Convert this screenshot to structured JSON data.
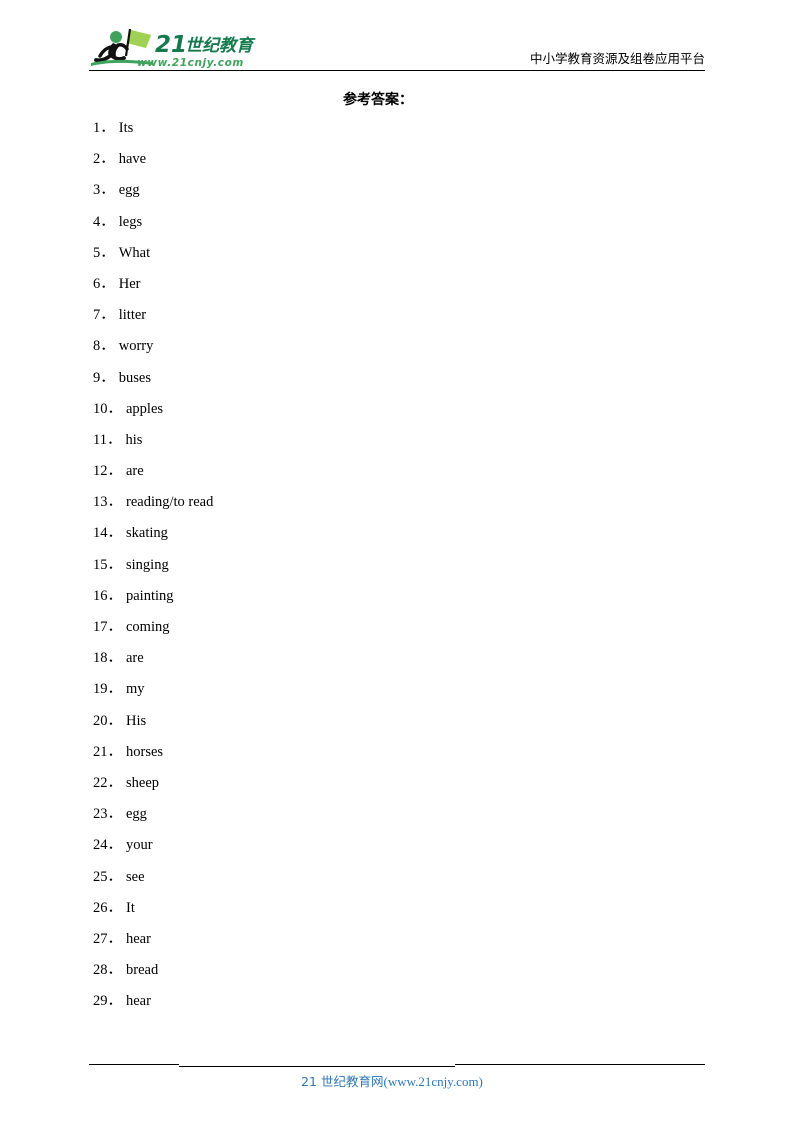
{
  "header": {
    "logo": {
      "brand_number": "21",
      "brand_cn": "世纪教育",
      "brand_url": "www.21cnjy.com",
      "icon_name": "running-figure-with-flag-logo",
      "colors": {
        "brand_dark_green": "#157a4e",
        "brand_mid_green": "#3fa35e",
        "brand_light_green": "#7ac143",
        "figure_black": "#111111"
      }
    },
    "tagline": "中小学教育资源及组卷应用平台"
  },
  "title": "参考答案：",
  "answers": [
    {
      "num": "1．",
      "text": "Its"
    },
    {
      "num": "2．",
      "text": "have"
    },
    {
      "num": "3．",
      "text": "egg"
    },
    {
      "num": "4．",
      "text": "legs"
    },
    {
      "num": "5．",
      "text": "What"
    },
    {
      "num": "6．",
      "text": "Her"
    },
    {
      "num": "7．",
      "text": "litter"
    },
    {
      "num": "8．",
      "text": "worry"
    },
    {
      "num": "9．",
      "text": "buses"
    },
    {
      "num": "10．",
      "text": "apples"
    },
    {
      "num": "11．",
      "text": "his"
    },
    {
      "num": "12．",
      "text": "are"
    },
    {
      "num": "13．",
      "text": "reading/to read"
    },
    {
      "num": "14．",
      "text": "skating"
    },
    {
      "num": "15．",
      "text": "singing"
    },
    {
      "num": "16．",
      "text": "painting"
    },
    {
      "num": "17．",
      "text": "coming"
    },
    {
      "num": "18．",
      "text": "are"
    },
    {
      "num": "19．",
      "text": "my"
    },
    {
      "num": "20．",
      "text": "His"
    },
    {
      "num": "21．",
      "text": "horses"
    },
    {
      "num": "22．",
      "text": "sheep"
    },
    {
      "num": "23．",
      "text": "egg"
    },
    {
      "num": "24．",
      "text": "your"
    },
    {
      "num": "25．",
      "text": "see"
    },
    {
      "num": "26．",
      "text": "It"
    },
    {
      "num": "27．",
      "text": "hear"
    },
    {
      "num": "28．",
      "text": "bread"
    },
    {
      "num": "29．",
      "text": "hear"
    }
  ],
  "footer": {
    "site_cn": "21 世纪教育网",
    "site_url": "(www.21cnjy.com)",
    "color": "#2e77b5"
  }
}
